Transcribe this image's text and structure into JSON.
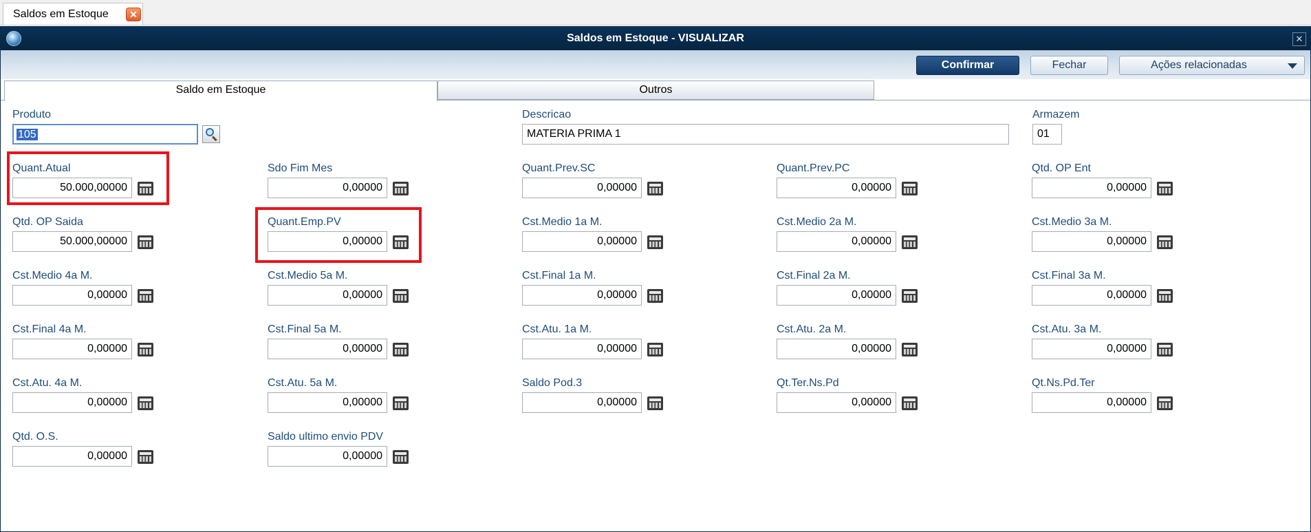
{
  "doc_tab": {
    "label": "Saldos em Estoque",
    "close_glyph": "✕"
  },
  "window": {
    "title": "Saldos em Estoque - VISUALIZAR",
    "close_glyph": "✕"
  },
  "toolbar": {
    "confirm": "Confirmar",
    "close": "Fechar",
    "actions": "Ações relacionadas"
  },
  "tabs": [
    "Saldo em Estoque",
    "Outros"
  ],
  "header_fields": {
    "produto": {
      "label": "Produto",
      "value": "105"
    },
    "descricao": {
      "label": "Descricao",
      "value": "MATERIA PRIMA 1"
    },
    "armazem": {
      "label": "Armazem",
      "value": "01"
    }
  },
  "fields": [
    {
      "label": "Quant.Atual",
      "value": "50.000,00000"
    },
    {
      "label": "Sdo Fim Mes",
      "value": "0,00000"
    },
    {
      "label": "Quant.Prev.SC",
      "value": "0,00000"
    },
    {
      "label": "Quant.Prev.PC",
      "value": "0,00000"
    },
    {
      "label": "Qtd. OP Ent",
      "value": "0,00000"
    },
    {
      "label": "Qtd. OP Saida",
      "value": "50.000,00000"
    },
    {
      "label": "Quant.Emp.PV",
      "value": "0,00000"
    },
    {
      "label": "Cst.Medio 1a M.",
      "value": "0,00000"
    },
    {
      "label": "Cst.Medio 2a M.",
      "value": "0,00000"
    },
    {
      "label": "Cst.Medio 3a M.",
      "value": "0,00000"
    },
    {
      "label": "Cst.Medio 4a M.",
      "value": "0,00000"
    },
    {
      "label": "Cst.Medio 5a M.",
      "value": "0,00000"
    },
    {
      "label": "Cst.Final 1a M.",
      "value": "0,00000"
    },
    {
      "label": "Cst.Final 2a M.",
      "value": "0,00000"
    },
    {
      "label": "Cst.Final 3a M.",
      "value": "0,00000"
    },
    {
      "label": "Cst.Final 4a M.",
      "value": "0,00000"
    },
    {
      "label": "Cst.Final 5a M.",
      "value": "0,00000"
    },
    {
      "label": "Cst.Atu. 1a M.",
      "value": "0,00000"
    },
    {
      "label": "Cst.Atu. 2a M.",
      "value": "0,00000"
    },
    {
      "label": "Cst.Atu. 3a M.",
      "value": "0,00000"
    },
    {
      "label": "Cst.Atu. 4a M.",
      "value": "0,00000"
    },
    {
      "label": "Cst.Atu. 5a M.",
      "value": "0,00000"
    },
    {
      "label": "Saldo Pod.3",
      "value": "0,00000"
    },
    {
      "label": "Qt.Ter.Ns.Pd",
      "value": "0,00000"
    },
    {
      "label": "Qt.Ns.Pd.Ter",
      "value": "0,00000"
    },
    {
      "label": "Qtd. O.S.",
      "value": "0,00000"
    },
    {
      "label": "Saldo ultimo envio PDV",
      "value": "0,00000"
    }
  ],
  "colors": {
    "highlight": "#e8141b",
    "titlebar": "#0a3158",
    "label": "#1f4d7a"
  }
}
